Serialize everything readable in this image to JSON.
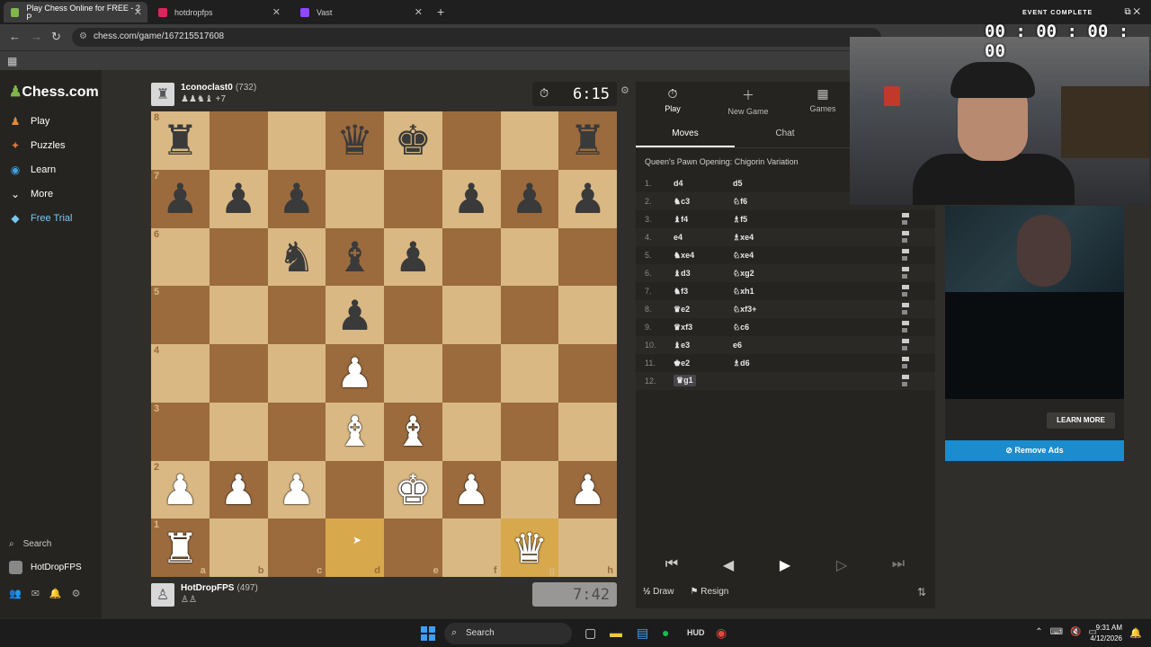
{
  "browser": {
    "tabs": [
      {
        "label": "Play Chess Online for FREE - 2 P",
        "color": "#81b64c",
        "active": true
      },
      {
        "label": "hotdropfps",
        "color": "#e0245e",
        "active": false
      },
      {
        "label": "Vast",
        "color": "#9146ff",
        "active": false
      }
    ],
    "url": "chess.com/game/167215517608"
  },
  "sidebar": {
    "logo": "Chess.com",
    "items": [
      {
        "label": "Play",
        "icon": "♟"
      },
      {
        "label": "Puzzles",
        "icon": "✦"
      },
      {
        "label": "Learn",
        "icon": "◉"
      },
      {
        "label": "More",
        "icon": "⌄"
      },
      {
        "label": "Free Trial",
        "icon": "◆"
      }
    ],
    "search_label": "Search",
    "username": "HotDropFPS"
  },
  "top_player": {
    "name": "1conoclast0",
    "rating": "(732)",
    "captured": "♟♟♞♝ +7",
    "clock": "6:15"
  },
  "bottom_player": {
    "name": "HotDropFPS",
    "rating": "(497)",
    "captured": "♙♙",
    "clock": "7:42"
  },
  "board": {
    "ranks": [
      "8",
      "7",
      "6",
      "5",
      "4",
      "3",
      "2",
      "1"
    ],
    "files": [
      "a",
      "b",
      "c",
      "d",
      "e",
      "f",
      "g",
      "h"
    ],
    "rows": [
      [
        "br",
        "",
        "",
        "bq",
        "bk",
        "",
        "",
        "br"
      ],
      [
        "bp",
        "bp",
        "bp",
        "",
        "",
        "bp",
        "bp",
        "bp"
      ],
      [
        "",
        "",
        "bn",
        "bb",
        "bp",
        "",
        "",
        ""
      ],
      [
        "",
        "",
        "",
        "bp",
        "",
        "",
        "",
        ""
      ],
      [
        "",
        "",
        "",
        "wp",
        "",
        "",
        "",
        ""
      ],
      [
        "",
        "",
        "",
        "wb",
        "wb",
        "",
        "",
        ""
      ],
      [
        "wp",
        "wp",
        "wp",
        "",
        "wk",
        "wp",
        "",
        "wp"
      ],
      [
        "wr",
        "",
        "",
        "",
        "",
        "",
        "wq",
        ""
      ]
    ],
    "highlight": [
      [
        7,
        3
      ],
      [
        7,
        6
      ]
    ]
  },
  "panel": {
    "tabs": [
      {
        "label": "Play",
        "icon": "⏱"
      },
      {
        "label": "New Game",
        "icon": "＋"
      },
      {
        "label": "Games",
        "icon": "▦"
      }
    ],
    "subtabs": [
      "Moves",
      "Chat"
    ],
    "opening": "Queen's Pawn Opening: Chigorin Variation",
    "moves": [
      {
        "no": "1.",
        "w": "d4",
        "b": "d5"
      },
      {
        "no": "2.",
        "w": "♞c3",
        "b": "♘f6"
      },
      {
        "no": "3.",
        "w": "♝f4",
        "b": "♗f5"
      },
      {
        "no": "4.",
        "w": "e4",
        "b": "♗xe4"
      },
      {
        "no": "5.",
        "w": "♞xe4",
        "b": "♘xe4"
      },
      {
        "no": "6.",
        "w": "♝d3",
        "b": "♘xg2"
      },
      {
        "no": "7.",
        "w": "♞f3",
        "b": "♘xh1"
      },
      {
        "no": "8.",
        "w": "♛e2",
        "b": "♘xf3+"
      },
      {
        "no": "9.",
        "w": "♛xf3",
        "b": "♘c6"
      },
      {
        "no": "10.",
        "w": "♝e3",
        "b": "e6"
      },
      {
        "no": "11.",
        "w": "♚e2",
        "b": "♗d6"
      },
      {
        "no": "12.",
        "w": "♛g1",
        "b": ""
      }
    ],
    "controls": [
      "⏮",
      "◀",
      "▶",
      "▷",
      "⏭"
    ],
    "draw_label": "Draw",
    "resign_label": "Resign"
  },
  "overlay": {
    "timer_title": "EVENT COMPLETE",
    "timer_value": "00 : 00 : 00 : 00",
    "learn_more": "LEARN MORE",
    "remove_ads": "Remove Ads"
  },
  "taskbar": {
    "search_label": "Search",
    "time": "9:31 AM",
    "date": "4/12/2026"
  }
}
